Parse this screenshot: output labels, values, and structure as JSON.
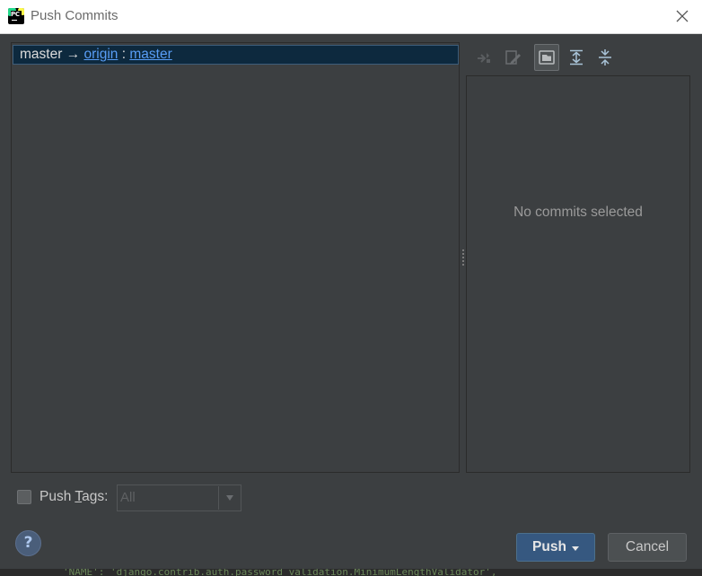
{
  "window": {
    "title": "Push Commits",
    "logo_text": "PC"
  },
  "branch_row": {
    "local": "master",
    "arrow": "→",
    "remote": "origin",
    "separator": ":",
    "remote_branch": "master"
  },
  "toolbar": {
    "buttons": [
      {
        "icon": "cherry-pick-icon",
        "enabled": false
      },
      {
        "icon": "edit-source-icon",
        "enabled": false
      },
      {
        "icon": "show-details-icon",
        "active": true
      },
      {
        "icon": "expand-all-icon",
        "enabled": true
      },
      {
        "icon": "collapse-all-icon",
        "enabled": true
      }
    ]
  },
  "details_panel": {
    "empty_text": "No commits selected"
  },
  "push_tags": {
    "label_prefix": "Push ",
    "label_mnemonic": "T",
    "label_suffix": "ags:",
    "selected": "All"
  },
  "footer": {
    "help_label": "?",
    "push_label": "Push",
    "cancel_label": "Cancel"
  },
  "background_code": "'NAME': 'django.contrib.auth.password_validation.MinimumLengthValidator',",
  "colors": {
    "accent": "#365880",
    "link": "#589df6",
    "panel_bg": "#3c3f41",
    "selection": "#0d293e"
  }
}
